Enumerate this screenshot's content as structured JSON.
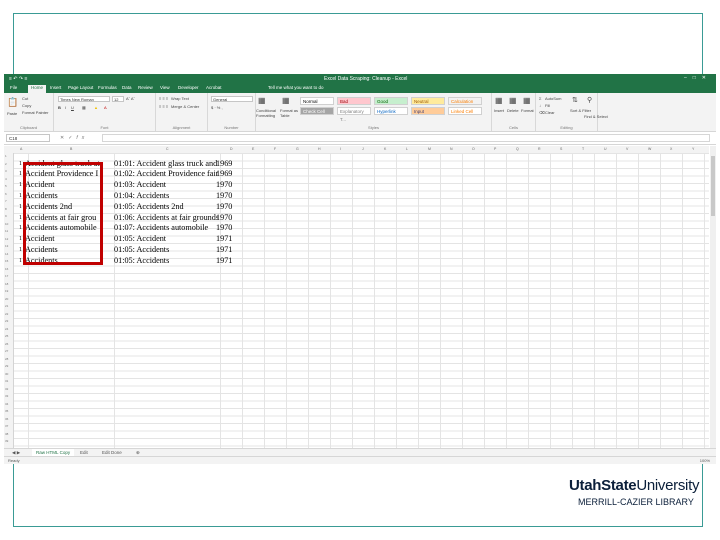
{
  "excel": {
    "title": "Excel Data Scraping: Cleanup - Excel",
    "qat": "≡ ↶ ↷ ≡",
    "tabs": [
      {
        "label": "File"
      },
      {
        "label": "Home"
      },
      {
        "label": "Insert"
      },
      {
        "label": "Page Layout"
      },
      {
        "label": "Formulas"
      },
      {
        "label": "Data"
      },
      {
        "label": "Review"
      },
      {
        "label": "View"
      },
      {
        "label": "Developer"
      },
      {
        "label": "Acrobat"
      },
      {
        "label": "Tell me what you want to do"
      }
    ],
    "ribbon": {
      "paste_label": "Paste",
      "cut_label": "Cut",
      "copy_label": "Copy",
      "format_painter_label": "Format Painter",
      "clipboard_group": "Clipboard",
      "font_name": "Times New Roman",
      "font_size": "12",
      "font_group": "Font",
      "wrap_text": "Wrap Text",
      "merge_center": "Merge & Center",
      "alignment_group": "Alignment",
      "number_format": "General",
      "number_group": "Number",
      "conditional_formatting": "Conditional Formatting",
      "format_as_table": "Format as Table",
      "styles": [
        {
          "label": "Normal",
          "bg": "#ffffff",
          "fg": "#000000"
        },
        {
          "label": "Bad",
          "bg": "#ffc7ce",
          "fg": "#9c0006"
        },
        {
          "label": "Good",
          "bg": "#c6efce",
          "fg": "#006100"
        },
        {
          "label": "Neutral",
          "bg": "#ffeb9c",
          "fg": "#9c5700"
        },
        {
          "label": "Calculation",
          "bg": "#f2f2f2",
          "fg": "#fa7d00"
        },
        {
          "label": "Check Cell",
          "bg": "#a5a5a5",
          "fg": "#ffffff"
        },
        {
          "label": "Explanatory T...",
          "bg": "#ffffff",
          "fg": "#7f7f7f"
        },
        {
          "label": "Hyperlink",
          "bg": "#ffffff",
          "fg": "#0563c1"
        },
        {
          "label": "Input",
          "bg": "#ffcc99",
          "fg": "#3f3f76"
        },
        {
          "label": "Linked Cell",
          "bg": "#ffffff",
          "fg": "#fa7d00"
        }
      ],
      "styles_group": "Styles",
      "insert_label": "Insert",
      "delete_label": "Delete",
      "format_label": "Format",
      "cells_group": "Cells",
      "autosum_label": "AutoSum",
      "fill_label": "Fill",
      "clear_label": "Clear",
      "sort_filter_label": "Sort & Filter",
      "find_select_label": "Find & Select",
      "editing_group": "Editing"
    },
    "name_box": "C18",
    "column_headers": [
      "A",
      "B",
      "C",
      "D",
      "E",
      "F",
      "G",
      "H",
      "I",
      "J",
      "K",
      "L",
      "M",
      "N",
      "O",
      "P",
      "Q",
      "R",
      "S",
      "T",
      "U",
      "V",
      "W",
      "X",
      "Y",
      "Z"
    ],
    "rows": [
      {
        "a": "1",
        "b": "Accident glass truck at",
        "c": "01:01: Accident glass truck and",
        "d": "1969"
      },
      {
        "a": "1",
        "b": "Accident Providence I",
        "c": "01:02: Accident Providence fair",
        "d": "1969"
      },
      {
        "a": "1",
        "b": "Accident",
        "c": "01:03: Accident",
        "d": "1970"
      },
      {
        "a": "1",
        "b": "Accidents",
        "c": "01:04: Accidents",
        "d": "1970"
      },
      {
        "a": "1",
        "b": "Accidents 2nd",
        "c": "01:05: Accidents 2nd",
        "d": "1970"
      },
      {
        "a": "1",
        "b": "Accidents at fair grou",
        "c": "01:06: Accidents at fair grounds",
        "d": "1970"
      },
      {
        "a": "1",
        "b": "Accidents automobile",
        "c": "01:07: Accidents automobile",
        "d": "1970"
      },
      {
        "a": "1",
        "b": "Accident",
        "c": "01:05: Accident",
        "d": "1971"
      },
      {
        "a": "1",
        "b": "Accidents",
        "c": "01:05: Accidents",
        "d": "1971"
      },
      {
        "a": "1",
        "b": "Accidents",
        "c": "01:05: Accidents",
        "d": "1971"
      }
    ],
    "sheet_tabs": [
      {
        "label": "Raw HTML Copy",
        "active": true
      },
      {
        "label": "Edit",
        "active": false
      },
      {
        "label": "Edit Done",
        "active": false
      }
    ],
    "add_sheet": "⊕",
    "status_ready": "Ready",
    "zoom": "100%"
  },
  "logo": {
    "word1": "UtahState",
    "word2": "University",
    "library": "MERRILL-CAZIER LIBRARY"
  },
  "colors": {
    "excel_green": "#217346",
    "highlight_red": "#c00000",
    "frame_teal": "#3a9b95",
    "usu_navy": "#0b1f3a"
  }
}
